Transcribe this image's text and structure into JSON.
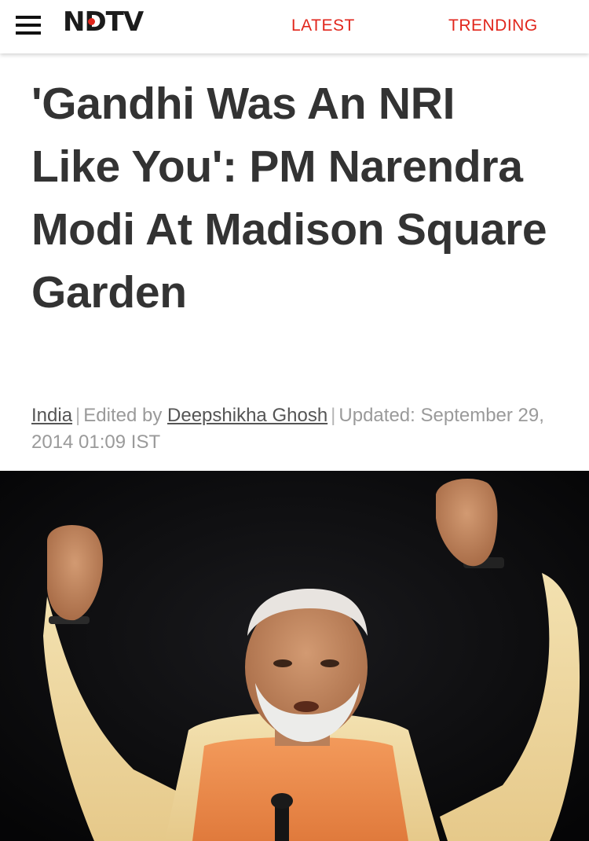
{
  "header": {
    "menu_icon": "hamburger-menu-icon",
    "logo_text": "NDTV",
    "nav": [
      {
        "label": "LATEST"
      },
      {
        "label": "TRENDING"
      }
    ],
    "accent_color": "#e1261c"
  },
  "article": {
    "headline": "'Gandhi Was An NRI Like You': PM Narendra Modi At Madison Square Garden",
    "byline": {
      "category": "India",
      "edited_by_label": "Edited by",
      "editor": "Deepshikha Ghosh",
      "updated_label": "Updated:",
      "updated_date": "September 29, 2014 01:09 IST"
    },
    "hero_image": "photo-of-man-raising-both-fists"
  }
}
